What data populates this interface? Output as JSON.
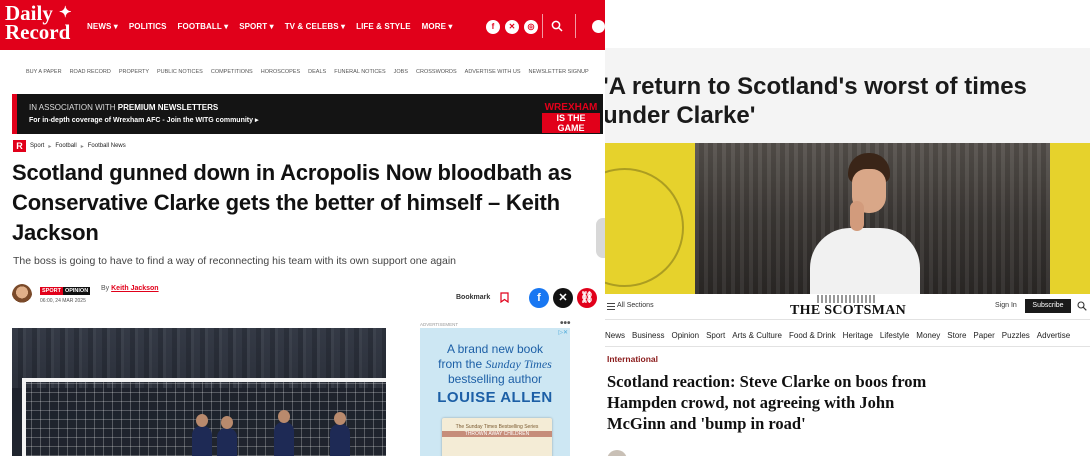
{
  "daily_record": {
    "logo_line1": "Daily",
    "logo_line2": "Record",
    "nav": [
      "NEWS ▾",
      "POLITICS",
      "FOOTBALL ▾",
      "SPORT ▾",
      "TV & CELEBS ▾",
      "LIFE & STYLE",
      "MORE ▾"
    ],
    "social_icons": [
      "facebook-icon",
      "x-icon",
      "instagram-icon"
    ],
    "subnav": [
      "BUY A PAPER",
      "ROAD RECORD",
      "PROPERTY",
      "PUBLIC NOTICES",
      "COMPETITIONS",
      "HOROSCOPES",
      "DEALS",
      "FUNERAL NOTICES",
      "JOBS",
      "CROSSWORDS",
      "ADVERTISE WITH US",
      "NEWSLETTER SIGNUP"
    ],
    "promo": {
      "line1_prefix": "IN ASSOCIATION WITH ",
      "line1_bold": "PREMIUM NEWSLETTERS",
      "line2": "For in-depth coverage of Wrexham AFC - Join the WITG community ▸",
      "brand_line1": "WREXHAM",
      "brand_line2": "IS THE GAME"
    },
    "breadcrumb": {
      "logo": "R",
      "items": [
        "Sport",
        "Football",
        "Football News"
      ],
      "separator": "▸"
    },
    "headline": "Scotland gunned down in Acropolis Now bloodbath as Conservative Clarke gets the better of himself – Keith Jackson",
    "standfirst": "The boss is going to have to find a way of reconnecting his team with its own support one again",
    "author": {
      "badge_left": "SPORT",
      "badge_right": "OPINION",
      "date": "06:00, 24 MAR 2025",
      "by_prefix": "By ",
      "name": "Keith Jackson"
    },
    "bookmark_label": "Bookmark",
    "share_icons": [
      "facebook-icon",
      "x-icon",
      "link-icon"
    ],
    "advert": {
      "label": "ADVERTISEMENT",
      "dots": "•••",
      "close": "▷✕",
      "line1": "A brand new book",
      "line2_prefix": "from the ",
      "line2_italic": "Sunday Times",
      "line3": "bestselling author",
      "author": "LOUISE ALLEN",
      "book_line1": "The Sunday Times Bestselling Series",
      "book_line2": "THROWN AWAY CHILDREN"
    },
    "colors": {
      "brand": "#e1001a",
      "promo_bg": "#141414"
    }
  },
  "bbc": {
    "headline": "'A return to Scotland's worst of times under Clarke'",
    "colors": {
      "accent": "#e6d22c"
    }
  },
  "scotsman": {
    "sections_label": "All Sections",
    "logo": "THE SCOTSMAN",
    "sign_in": "Sign In",
    "subscribe": "Subscribe",
    "nav": [
      "News",
      "Business",
      "Opinion",
      "Sport",
      "Arts & Culture",
      "Food & Drink",
      "Heritage",
      "Lifestyle",
      "Money",
      "Store",
      "Paper",
      "Puzzles",
      "Advertise"
    ],
    "kicker": "International",
    "headline": "Scotland reaction: Steve Clarke on boos from Hampden crowd, not agreeing with John McGinn and 'bump in road'",
    "colors": {
      "kicker": "#8a1a1a"
    }
  }
}
